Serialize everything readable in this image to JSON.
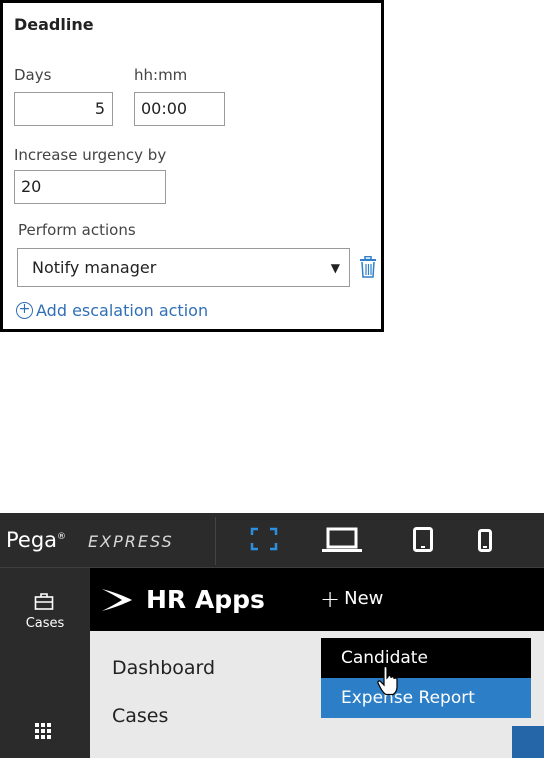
{
  "deadline": {
    "title": "Deadline",
    "days_label": "Days",
    "days_value": "5",
    "hhmm_label": "hh:mm",
    "hhmm_value": "00:00",
    "urgency_label": "Increase urgency by",
    "urgency_value": "20",
    "actions_label": "Perform actions",
    "action_selected": "Notify manager",
    "add_action_label": "Add escalation action",
    "link_color": "#2f6fb5"
  },
  "pega": {
    "brand": "Pega",
    "brand_mark": "®",
    "product": "EXPRESS",
    "devices": [
      "fullscreen-icon",
      "laptop-icon",
      "tablet-icon",
      "phone-icon"
    ],
    "accent_color": "#2c7fc7",
    "nav": {
      "cases_label": "Cases"
    },
    "app_title": "HR Apps",
    "new_label": "New",
    "menu": [
      "Dashboard",
      "Cases"
    ],
    "new_menu": {
      "items": [
        "Candidate",
        "Expense Report"
      ],
      "highlighted": "Expense Report"
    }
  }
}
